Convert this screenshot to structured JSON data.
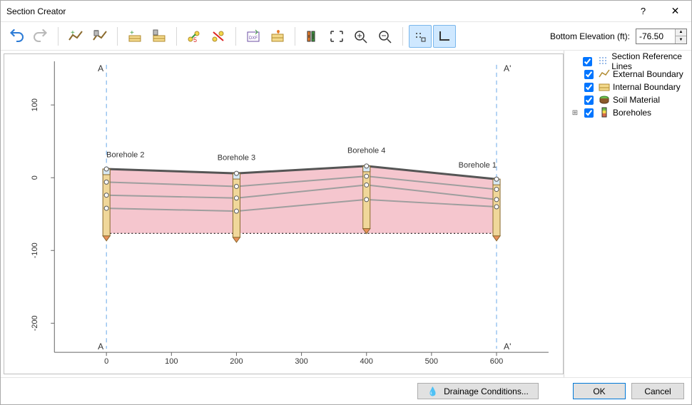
{
  "window": {
    "title": "Section Creator",
    "help_glyph": "?",
    "close_glyph": "✕"
  },
  "toolbar": {
    "elevation_label": "Bottom Elevation (ft):",
    "elevation_value": "-76.50"
  },
  "tree": {
    "items": [
      {
        "label": "Section Reference Lines"
      },
      {
        "label": "External Boundary"
      },
      {
        "label": "Internal Boundary"
      },
      {
        "label": "Soil Material"
      },
      {
        "label": "Boreholes",
        "expandable": true
      }
    ]
  },
  "footer": {
    "drainage": "Drainage Conditions...",
    "ok": "OK",
    "cancel": "Cancel"
  },
  "chart_data": {
    "type": "section",
    "x_range": [
      -80,
      680
    ],
    "y_range": [
      -240,
      160
    ],
    "x_ticks": [
      0,
      100,
      200,
      300,
      400,
      500,
      600
    ],
    "y_ticks": [
      -200,
      -100,
      0,
      100
    ],
    "section_markers": {
      "left": {
        "label": "A",
        "x": 0
      },
      "right": {
        "label": "A'",
        "x": 600
      }
    },
    "boreholes": [
      {
        "name": "Borehole 2",
        "x": 0,
        "top": 12,
        "bottom": -80,
        "label_y": 28
      },
      {
        "name": "Borehole 3",
        "x": 200,
        "top": 6,
        "bottom": -82,
        "label_y": 24
      },
      {
        "name": "Borehole 4",
        "x": 400,
        "top": 16,
        "bottom": -70,
        "label_y": 34
      },
      {
        "name": "Borehole 1",
        "x": 600,
        "top": -2,
        "bottom": -80,
        "label_y": 14
      }
    ],
    "layer_lines": [
      [
        {
          "x": 0,
          "y": 12
        },
        {
          "x": 200,
          "y": 6
        },
        {
          "x": 400,
          "y": 16
        },
        {
          "x": 600,
          "y": -2
        }
      ],
      [
        {
          "x": 0,
          "y": -6
        },
        {
          "x": 200,
          "y": -12
        },
        {
          "x": 400,
          "y": 2
        },
        {
          "x": 600,
          "y": -16
        }
      ],
      [
        {
          "x": 0,
          "y": -24
        },
        {
          "x": 200,
          "y": -28
        },
        {
          "x": 400,
          "y": -10
        },
        {
          "x": 600,
          "y": -30
        }
      ],
      [
        {
          "x": 0,
          "y": -42
        },
        {
          "x": 200,
          "y": -46
        },
        {
          "x": 400,
          "y": -30
        },
        {
          "x": 600,
          "y": -40
        }
      ]
    ],
    "section_bottom_y": -76.5,
    "fill_color": "#f5c6ce",
    "colors": {
      "section_line": "#6aa9e9",
      "ground_line": "#555",
      "layer_line": "#9e9e9e",
      "bottom_line": "#111"
    }
  }
}
